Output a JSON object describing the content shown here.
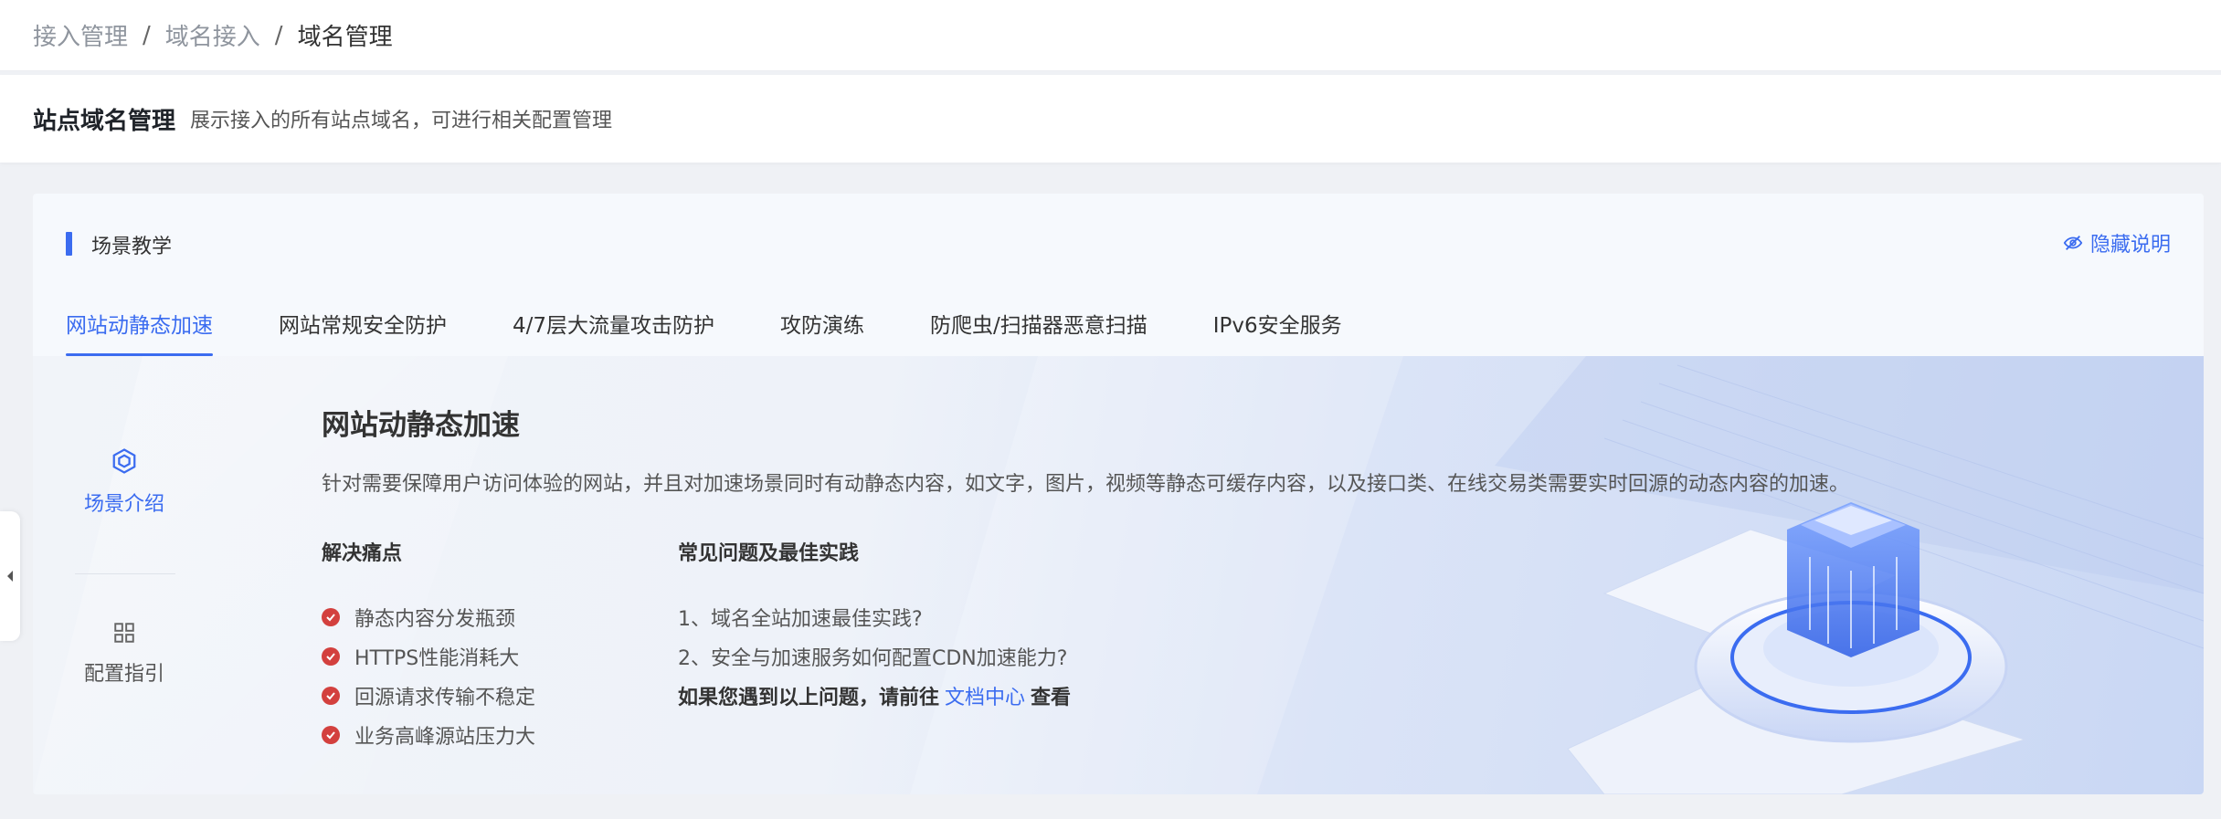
{
  "breadcrumb": [
    "接入管理",
    "域名接入",
    "域名管理"
  ],
  "breadcrumb_sep": "/",
  "header": {
    "title": "站点域名管理",
    "desc": "展示接入的所有站点域名，可进行相关配置管理"
  },
  "card": {
    "title": "场景教学",
    "hide_label": "隐藏说明",
    "tabs": [
      "网站动静态加速",
      "网站常规安全防护",
      "4/7层大流量攻击防护",
      "攻防演练",
      "防爬虫/扫描器恶意扫描",
      "IPv6安全服务"
    ],
    "active_tab": 0,
    "side": [
      {
        "label": "场景介绍",
        "icon": "cube-icon",
        "active": true
      },
      {
        "label": "配置指引",
        "icon": "grid-icon",
        "active": false
      }
    ],
    "content": {
      "title": "网站动静态加速",
      "desc": "针对需要保障用户访问体验的网站，并且对加速场景同时有动静态内容，如文字，图片，视频等静态可缓存内容，以及接口类、在线交易类需要实时回源的动态内容的加速。",
      "pain_title": "解决痛点",
      "pains": [
        "静态内容分发瓶颈",
        "HTTPS性能消耗大",
        "回源请求传输不稳定",
        "业务高峰源站压力大"
      ],
      "faq_title": "常见问题及最佳实践",
      "faqs": [
        "1、域名全站加速最佳实践?",
        "2、安全与加速服务如何配置CDN加速能力?"
      ],
      "note_prefix": "如果您遇到以上问题，请前往",
      "note_link": "文档中心",
      "note_suffix": "查看"
    }
  },
  "colors": {
    "accent": "#3b6cf0",
    "check": "#d3403e"
  }
}
